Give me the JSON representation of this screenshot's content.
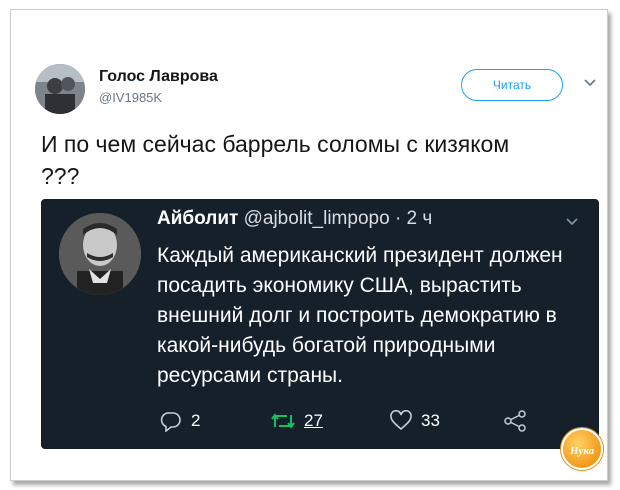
{
  "tweet": {
    "display_name": "Голос Лаврова",
    "handle": "@IV1985K",
    "follow_label": "Читать",
    "text": "И по чем сейчас баррель соломы с кизяком ???"
  },
  "quoted": {
    "name": "Айболит",
    "handle": "@ajbolit_limpopo",
    "separator": "·",
    "time": "2 ч",
    "text": "Каждый американский президент должен посадить экономику США, вырастить внешний долг и построить демократию в какой-нибудь богатой природными ресурсами страны.",
    "actions": {
      "replies": "2",
      "retweets": "27",
      "likes": "33"
    }
  },
  "watermark": {
    "text": "Нука"
  },
  "colors": {
    "accent": "#1da1f2",
    "embed_bg": "#15202b",
    "retweet_green": "#17bf63"
  },
  "icons": {
    "caret": "chevron-down-icon",
    "reply": "reply-icon",
    "retweet": "retweet-icon",
    "like": "heart-icon",
    "share": "share-icon"
  }
}
